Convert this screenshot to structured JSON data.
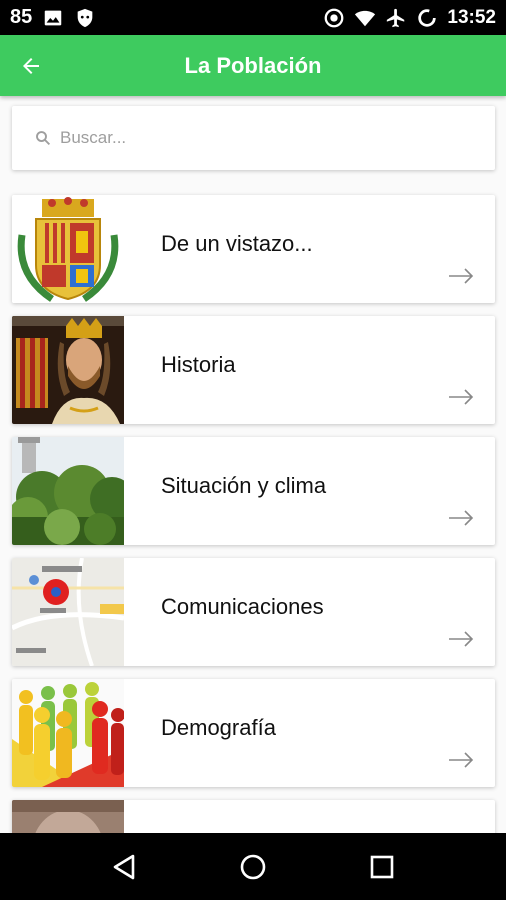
{
  "status_bar": {
    "left_number": "85",
    "time": "13:52",
    "icons": [
      "image-icon",
      "shield-icon",
      "data-saver-icon",
      "wifi-icon",
      "airplane-icon",
      "sync-icon"
    ]
  },
  "app_bar": {
    "title": "La Población",
    "back_icon": "arrow-left-icon",
    "color": "#3ecb5f"
  },
  "search": {
    "placeholder": "Buscar...",
    "value": ""
  },
  "items": [
    {
      "label": "De un vistazo...",
      "thumb": "coat-of-arms"
    },
    {
      "label": "Historia",
      "thumb": "king-portrait"
    },
    {
      "label": "Situación y clima",
      "thumb": "trees-landscape"
    },
    {
      "label": "Comunicaciones",
      "thumb": "map"
    },
    {
      "label": "Demografía",
      "thumb": "people-figures"
    },
    {
      "label": "",
      "thumb": "portrait-partial"
    }
  ],
  "nav_bar": {
    "icons": [
      "back-triangle-icon",
      "home-circle-icon",
      "recents-square-icon"
    ]
  }
}
